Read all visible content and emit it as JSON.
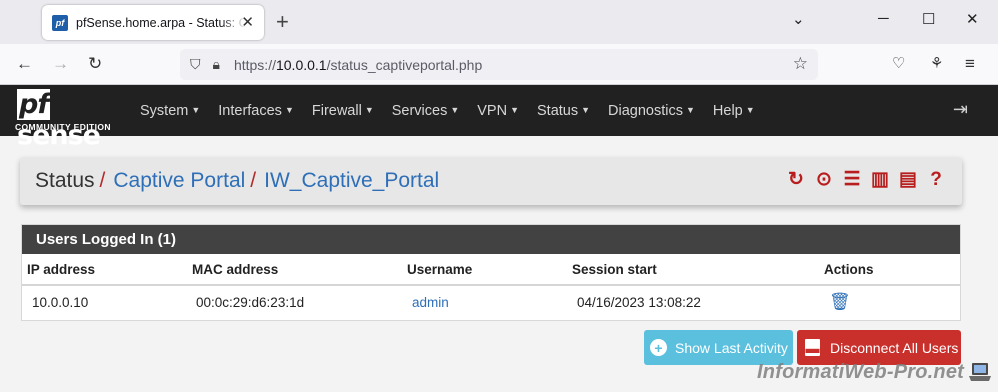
{
  "browser": {
    "tab_title": "pfSense.home.arpa - Status: Captive Portal: IW_Captive_Portal",
    "tab_close": "✕",
    "new_tab": "+",
    "url_prefix": "https://",
    "url_host": "10.0.0.1",
    "url_path": "/status_captiveportal.php"
  },
  "pfsense": {
    "logo_text": "sense",
    "logo_pf": "pf",
    "logo_sub": "COMMUNITY EDITION",
    "menu": [
      "System",
      "Interfaces",
      "Firewall",
      "Services",
      "VPN",
      "Status",
      "Diagnostics",
      "Help"
    ]
  },
  "breadcrumb": {
    "root": "Status",
    "sep": "/",
    "item1": "Captive Portal",
    "item2": "IW_Captive_Portal"
  },
  "users_panel": {
    "heading": "Users Logged In (1)",
    "columns": [
      "IP address",
      "MAC address",
      "Username",
      "Session start",
      "Actions"
    ],
    "rows": [
      {
        "ip": "10.0.0.10",
        "mac": "00:0c:29:d6:23:1d",
        "username": "admin",
        "session_start": "04/16/2023 13:08:22"
      }
    ]
  },
  "buttons": {
    "show_last_activity": "Show Last Activity",
    "disconnect_all": "Disconnect All Users"
  },
  "watermark": "InformatiWeb-Pro.net",
  "colors": {
    "header_bg": "#212121",
    "link": "#2e6fb7",
    "accent_red": "#b81e1e",
    "info": "#5bc0de",
    "danger": "#c9302c"
  }
}
